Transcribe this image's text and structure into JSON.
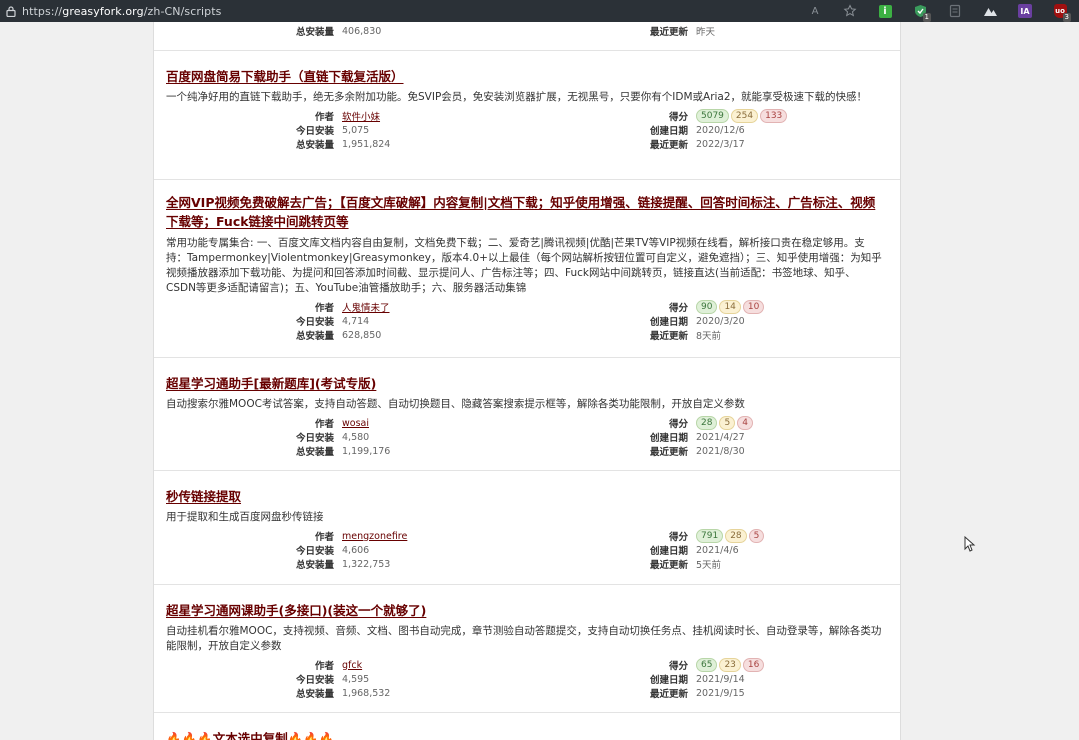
{
  "browser": {
    "url_prefix": "https://",
    "url_domain": "greasyfork.org",
    "url_path": "/zh-CN/scripts",
    "extensions": [
      {
        "name": "read-aloud-icon",
        "text": "A"
      },
      {
        "name": "favorite-icon",
        "text": ""
      },
      {
        "name": "info-ext-icon",
        "text": "i"
      },
      {
        "name": "shield-ext-icon",
        "text": "",
        "badge": "1"
      },
      {
        "name": "page-ext-icon",
        "text": ""
      },
      {
        "name": "mountain-ext-icon",
        "text": ""
      },
      {
        "name": "ia-ext-icon",
        "text": "IA"
      },
      {
        "name": "ublock-icon",
        "text": "uo",
        "badge": "3"
      }
    ]
  },
  "labels": {
    "author": "作者",
    "daily": "今日安装",
    "total": "总安装量",
    "rating": "得分",
    "created": "创建日期",
    "updated": "最近更新"
  },
  "top_partial": {
    "total": "406,830",
    "updated": "昨天"
  },
  "scripts": [
    {
      "title": "百度网盘简易下载助手（直链下载复活版）",
      "desc": "一个纯净好用的直链下载助手，绝无多余附加功能。免SVIP会员，免安装浏览器扩展，无视黑号，只要你有个IDM或Aria2，就能享受极速下载的快感！",
      "author": "软件小妹",
      "daily": "5,075",
      "total": "1,951,824",
      "ratings": [
        "5079",
        "254",
        "133"
      ],
      "created": "2020/12/6",
      "updated": "2022/3/17"
    },
    {
      "title": "全网VIP视频免费破解去广告；【百度文库破解】内容复制|文档下载；知乎使用增强、链接提醒、回答时间标注、广告标注、视频下载等；Fuck链接中间跳转页等",
      "desc": "常用功能专属集合: 一、百度文库文档内容自由复制，文档免费下载；二、爱奇艺|腾讯视频|优酷|芒果TV等VIP视频在线看，解析接口贵在稳定够用。支持：Tampermonkey|Violentmonkey|Greasymonkey，版本4.0+以上最佳（每个网站解析按钮位置可自定义，避免遮挡）；三、知乎使用增强：为知乎视频播放器添加下载功能、为提问和回答添加时间截、显示提问人、广告标注等；四、Fuck网站中间跳转页，链接直达(当前适配：书签地球、知乎、CSDN等更多适配请留言)；五、YouTube油管播放助手；六、服务器活动集锦",
      "author": "人鬼情未了",
      "daily": "4,714",
      "total": "628,850",
      "ratings": [
        "90",
        "14",
        "10"
      ],
      "created": "2020/3/20",
      "updated": "8天前"
    },
    {
      "title": "超星学习通助手[最新题库](考试专版)",
      "desc": "自动搜索尔雅MOOC考试答案，支持自动答题、自动切换题目、隐藏答案搜索提示框等，解除各类功能限制，开放自定义参数",
      "author": "wosai",
      "daily": "4,580",
      "total": "1,199,176",
      "ratings": [
        "28",
        "5",
        "4"
      ],
      "created": "2021/4/27",
      "updated": "2021/8/30"
    },
    {
      "title": "秒传链接提取",
      "desc": "用于提取和生成百度网盘秒传链接",
      "author": "mengzonefire",
      "daily": "4,606",
      "total": "1,322,753",
      "ratings": [
        "791",
        "28",
        "5"
      ],
      "created": "2021/4/6",
      "updated": "5天前"
    },
    {
      "title": "超星学习通网课助手(多接口)(装这一个就够了)",
      "desc": "自动挂机看尔雅MOOC，支持视频、音频、文档、图书自动完成，章节测验自动答题提交，支持自动切换任务点、挂机阅读时长、自动登录等，解除各类功能限制，开放自定义参数",
      "author": "gfck",
      "daily": "4,595",
      "total": "1,968,532",
      "ratings": [
        "65",
        "23",
        "16"
      ],
      "created": "2021/9/14",
      "updated": "2021/9/15"
    }
  ],
  "bottom_partial": {
    "title_emoji_left": "🔥🔥🔥",
    "title_text": "文本选中复制",
    "title_emoji_right": "🔥🔥🔥"
  }
}
